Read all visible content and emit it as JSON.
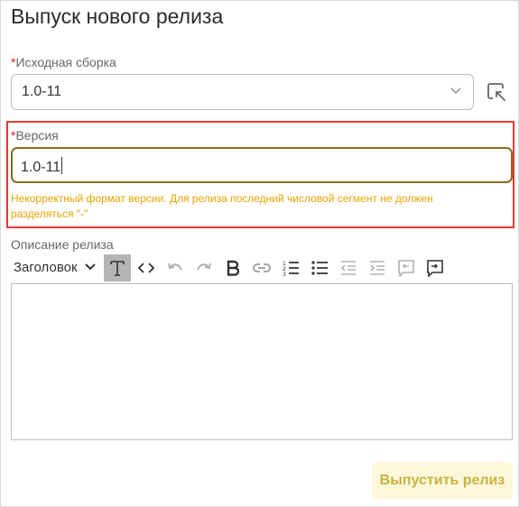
{
  "page": {
    "title": "Выпуск нового релиза"
  },
  "source_build": {
    "required_mark": "*",
    "label": "Исходная сборка",
    "value": "1.0-11",
    "side_icon": "open-in-window-icon"
  },
  "version": {
    "required_mark": "*",
    "label": "Версия",
    "value": "1.0-11",
    "error": "Некорректный формат версии. Для релиза последний числовой сегмент не должен разделяться \"-\""
  },
  "description": {
    "label": "Описание релиза",
    "toolbar": {
      "heading_label": "Заголовок",
      "buttons": [
        "clear-format-icon",
        "code-icon",
        "undo-icon",
        "redo-icon",
        "bold-icon",
        "link-icon",
        "numbered-list-icon",
        "bulleted-list-icon",
        "outdent-icon",
        "indent-icon",
        "comment-icon",
        "insert-comment-icon"
      ]
    }
  },
  "actions": {
    "release_label": "Выпустить релиз"
  },
  "colors": {
    "error_border": "#e53935",
    "input_border": "#8a6a1f",
    "error_text": "#e8a200",
    "primary_bg": "#fdf8dc",
    "primary_text": "#c9b23b"
  }
}
